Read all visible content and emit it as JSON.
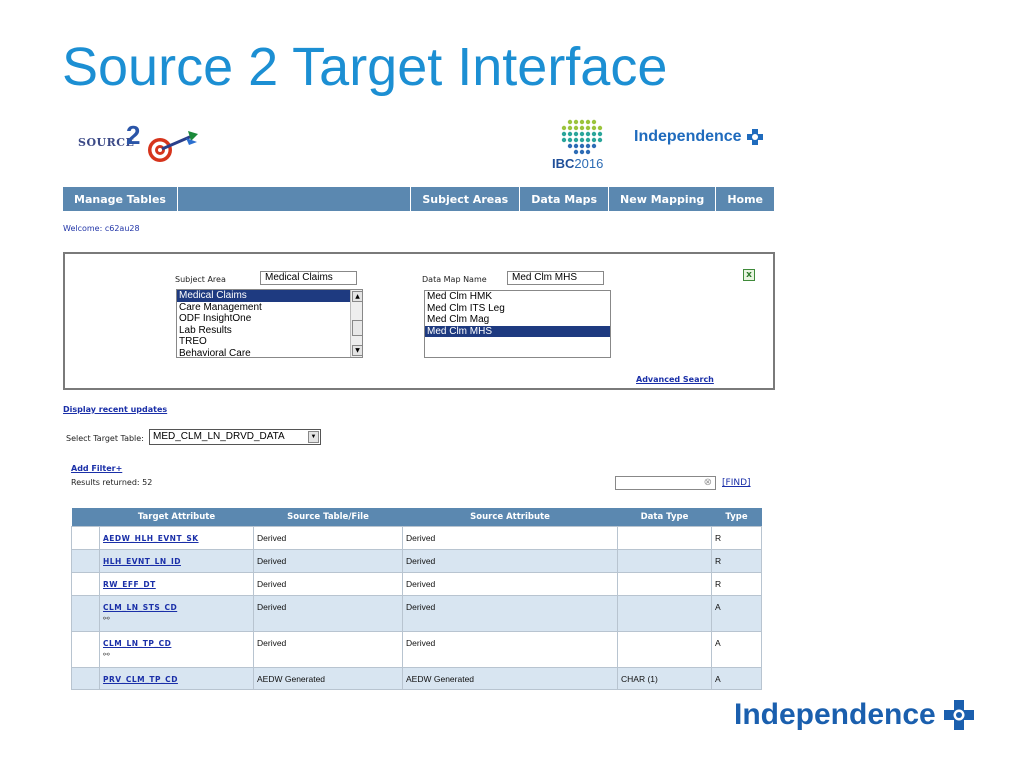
{
  "slide_title": "Source 2 Target Interface",
  "logos": {
    "s2t_source": "SOURCE",
    "s2t_two": "2",
    "ibc_bold": "IBC",
    "ibc_year": "2016",
    "independence_small": "Independence",
    "independence_big": "Independence"
  },
  "nav": {
    "manage_tables": "Manage Tables",
    "subject_areas": "Subject Areas",
    "data_maps": "Data Maps",
    "new_mapping": "New Mapping",
    "home": "Home"
  },
  "welcome": "Welcome: c62au28",
  "search": {
    "subject_area_label": "Subject Area",
    "subject_area_value": "Medical Claims",
    "subject_area_options": [
      "Medical Claims",
      "Care Management",
      "ODF InsightOne",
      "Lab Results",
      "TREO",
      "Behavioral Care"
    ],
    "data_map_label": "Data Map Name",
    "data_map_value": "Med Clm MHS",
    "data_map_options": [
      "Med Clm HMK",
      "Med Clm ITS Leg",
      "Med Clm Mag",
      "Med Clm MHS"
    ],
    "advanced_search": "Advanced Search",
    "excel_icon": "excel-icon"
  },
  "display_recent": "Display recent updates",
  "target_table": {
    "label": "Select Target Table:",
    "value": "MED_CLM_LN_DRVD_DATA"
  },
  "add_filter": "Add Filter+",
  "results_returned": "Results returned: 52",
  "find": "[FIND]",
  "table": {
    "headers": [
      "",
      "Target Attribute",
      "Source Table/File",
      "Source Attribute",
      "Data Type",
      "Type"
    ],
    "rows": [
      {
        "attr": "AEDW_HLH_EVNT_SK",
        "src_table": "Derived",
        "src_attr": "Derived",
        "dtype": "",
        "type": "R",
        "link": false
      },
      {
        "attr": "HLH_EVNT_LN_ID",
        "src_table": "Derived",
        "src_attr": "Derived",
        "dtype": "",
        "type": "R",
        "link": false
      },
      {
        "attr": "RW_EFF_DT",
        "src_table": "Derived",
        "src_attr": "Derived",
        "dtype": "",
        "type": "R",
        "link": false
      },
      {
        "attr": "CLM_LN_STS_CD",
        "src_table": "Derived",
        "src_attr": "Derived",
        "dtype": "",
        "type": "A",
        "link": true
      },
      {
        "attr": "CLM_LN_TP_CD",
        "src_table": "Derived",
        "src_attr": "Derived",
        "dtype": "",
        "type": "A",
        "link": true
      },
      {
        "attr": "PRV_CLM_TP_CD",
        "src_table": "AEDW Generated",
        "src_attr": "AEDW Generated",
        "dtype": "CHAR (1)",
        "type": "A",
        "link": false
      }
    ]
  },
  "colors": {
    "title_blue": "#1c8fd3",
    "nav_blue": "#5b88b0",
    "row_alt": "#d8e5f1",
    "selected": "#1e3a80"
  }
}
